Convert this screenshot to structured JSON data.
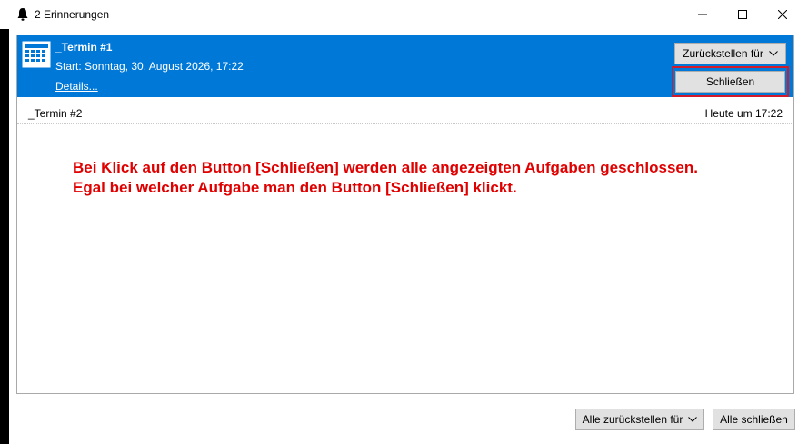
{
  "window": {
    "title": "2 Erinnerungen",
    "icon": "bell-icon"
  },
  "reminders": [
    {
      "title": "_Termin #1",
      "start": "Start: Sonntag, 30. August 2026, 17:22",
      "details_link": "Details...",
      "snooze_button": "Zurückstellen für",
      "dismiss_button": "Schließen",
      "selected": true
    },
    {
      "title": "_Termin #2",
      "time": "Heute um 17:22",
      "selected": false
    }
  ],
  "annotation": {
    "line1": "Bei Klick auf den Button [Schließen] werden alle angezeigten Aufgaben geschlossen.",
    "line2": "Egal bei welcher Aufgabe man den Button [Schließen] klickt.",
    "color": "#e00000"
  },
  "footer": {
    "snooze_all_button": "Alle zurückstellen für",
    "dismiss_all_button": "Alle schließen"
  },
  "colors": {
    "selection": "#0078d7",
    "highlight_border": "#d11a2a"
  }
}
